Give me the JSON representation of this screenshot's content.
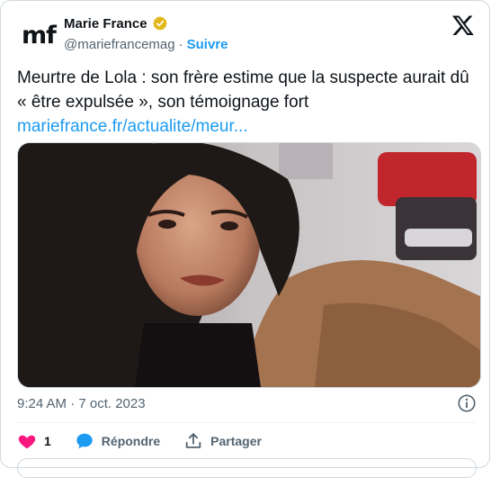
{
  "author": {
    "avatar_text": "mf",
    "display_name": "Marie France",
    "handle": "@mariefrancemag",
    "separator": "·",
    "follow_label": "Suivre"
  },
  "tweet": {
    "text": "Meurtre de Lola : son frère estime que la suspecte aurait dû « être expulsée », son témoignage fort",
    "link": "mariefrance.fr/actualite/meur..."
  },
  "meta": {
    "timestamp": "9:24 AM · 7 oct. 2023"
  },
  "actions": {
    "like_count": "1",
    "reply_label": "Répondre",
    "share_label": "Partager"
  },
  "colors": {
    "accent": "#1d9bf0",
    "like": "#f91880",
    "verified": "#e2b719",
    "muted": "#536471"
  },
  "icons": {
    "verified": "verified-badge-icon",
    "logo": "x-logo-icon",
    "info": "info-icon",
    "like": "heart-icon",
    "reply": "speech-bubble-icon",
    "share": "share-upload-icon"
  }
}
